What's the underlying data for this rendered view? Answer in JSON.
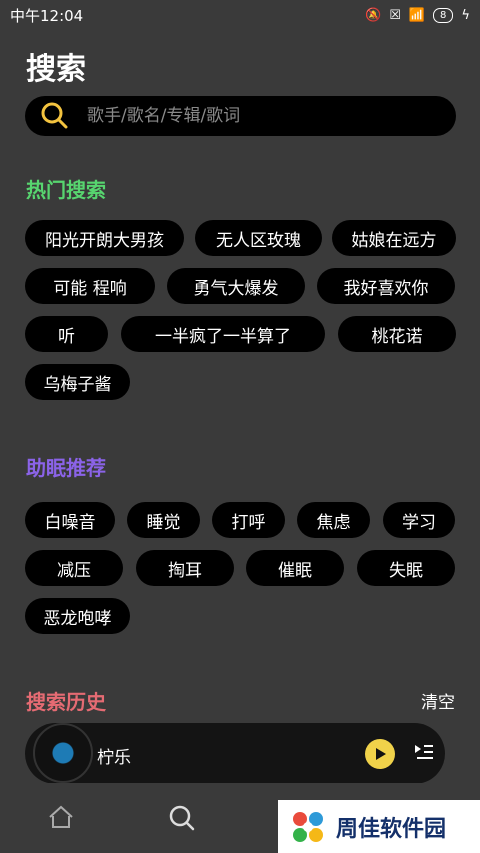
{
  "status": {
    "time": "中午12:04",
    "battery": "8"
  },
  "page": {
    "title": "搜索"
  },
  "search": {
    "placeholder": "歌手/歌名/专辑/歌词"
  },
  "hot": {
    "title": "热门搜索",
    "color": "#57d56f",
    "items": [
      "阳光开朗大男孩",
      "无人区玫瑰",
      "姑娘在远方",
      "可能 程响",
      "勇气大爆发",
      "我好喜欢你",
      "听",
      "一半疯了一半算了",
      "桃花诺",
      "乌梅子酱"
    ]
  },
  "sleep": {
    "title": "助眠推荐",
    "color": "#8b63e8",
    "items": [
      "白噪音",
      "睡觉",
      "打呼",
      "焦虑",
      "学习",
      "减压",
      "掏耳",
      "催眠",
      "失眠",
      "恶龙咆哮"
    ]
  },
  "history": {
    "title": "搜索历史",
    "color": "#e56b73",
    "clear_label": "清空"
  },
  "player": {
    "title": "柠乐"
  },
  "watermark": {
    "text": "周佳软件园"
  },
  "icons": {
    "search": "search-icon",
    "play": "play-icon",
    "queue": "playlist-icon",
    "home": "home-icon"
  }
}
